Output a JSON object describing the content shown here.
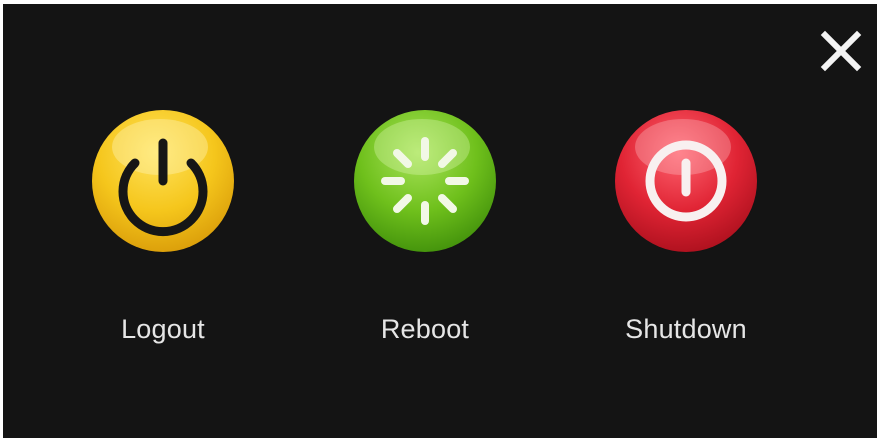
{
  "dialog": {
    "close_icon": "close-x-icon",
    "options": [
      {
        "label": "Logout",
        "icon": "power-icon",
        "color": "#f2c21a"
      },
      {
        "label": "Reboot",
        "icon": "loading-spinner-icon",
        "color": "#72c21a"
      },
      {
        "label": "Shutdown",
        "icon": "power-off-icon",
        "color": "#e02434"
      }
    ]
  }
}
